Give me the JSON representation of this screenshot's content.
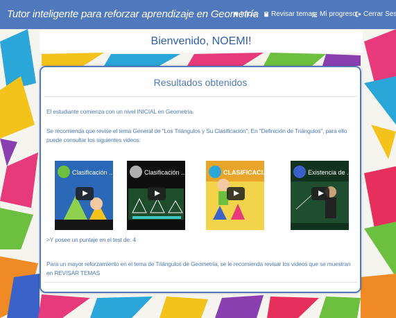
{
  "navbar": {
    "brand": "Tutor inteligente para reforzar aprendizaje en Geometría",
    "items": [
      {
        "label": "Inicio",
        "icon": "home-icon"
      },
      {
        "label": "Revisar temas",
        "icon": "book-icon"
      },
      {
        "label": "Mi progreso",
        "icon": "list-icon"
      },
      {
        "label": "Cerrar Sesión",
        "icon": "logout-icon"
      }
    ]
  },
  "welcome": "Bienvenido, NOEMI!",
  "results": {
    "title": "Resultados obtenidos",
    "level_text": "El estudiante comienza con un nivel INICIAL en Geometría.",
    "recommendation": "Se recomienda que revise el tema General de \"Los Triángulos y Su Clasificación\"; En \"Definición de Triángulos\", para ello puede consultar los siguientes videos:",
    "score_text": ">Y posee un puntaje en el test de: 4",
    "footer_text": "Para un mayor reforzamiento en el tema de Triángulos de Geometría, se le recomienda revisar los videos que se muestran en REVISAR TEMAS"
  },
  "videos": [
    {
      "title": "Clasificación ..."
    },
    {
      "title": "Clasificación ..."
    },
    {
      "title": "CLASIFICACI..."
    },
    {
      "title": "Existencia de ..."
    }
  ],
  "colors": {
    "navbar": "#4f78bd",
    "text_blue": "#4d7ab5",
    "welcome_blue": "#2f5fa8"
  }
}
